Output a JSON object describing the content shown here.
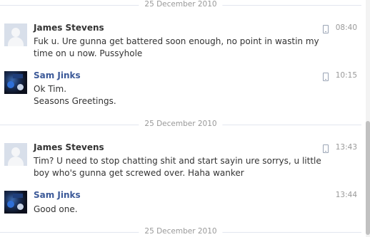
{
  "date_separators": {
    "top": "25 December 2010",
    "middle": "25 December 2010",
    "bottom": "25 December 2010"
  },
  "messages": [
    {
      "sender": "James Stevens",
      "time": "08:40",
      "mobile": true,
      "lines": [
        "Fuk u. Ure gunna get battered soon enough, no point in wastin my",
        "time on u now. Pussyhole"
      ]
    },
    {
      "sender": "Sam Jinks",
      "time": "10:15",
      "mobile": true,
      "lines": [
        "Ok Tim.",
        "Seasons Greetings."
      ]
    },
    {
      "sender": "James Stevens",
      "time": "13:43",
      "mobile": true,
      "lines": [
        "Tim? U need to stop chatting shit and start sayin ure sorrys, u little",
        "boy who's gunna get screwed over. Haha wanker"
      ]
    },
    {
      "sender": "Sam Jinks",
      "time": "13:44",
      "mobile": false,
      "lines": [
        "Good one."
      ]
    }
  ],
  "icons": {
    "mobile": "mobile-phone-icon",
    "default_avatar": "default-avatar-silhouette"
  },
  "colors": {
    "sender_blue": "#3b5998",
    "timestamp_gray": "#999999",
    "separator_line": "#e2e6ef"
  }
}
